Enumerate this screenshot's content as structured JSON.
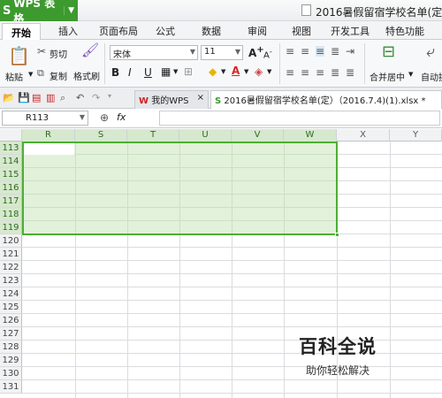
{
  "app": {
    "name": "WPS 表格",
    "logo": "S",
    "doc_title": "2016暑假留宿学校名单(定"
  },
  "menu": {
    "tabs": [
      "开始",
      "插入",
      "页面布局",
      "公式",
      "数据",
      "审阅",
      "视图",
      "开发工具",
      "特色功能"
    ]
  },
  "ribbon": {
    "paste": "粘贴",
    "cut": "剪切",
    "copy": "复制",
    "format_painter": "格式刷",
    "font_name": "宋体",
    "font_size": "11",
    "bold": "B",
    "italic": "I",
    "underline": "U",
    "grow_font": "A",
    "shrink_font": "A",
    "merge_center": "合并居中",
    "auto_wrap": "自动换"
  },
  "tabbar": {
    "home_tab": "我的WPS",
    "doc_tab": "2016暑假留宿学校名单(定）（2016.7.4)(1).xlsx *"
  },
  "formula": {
    "namebox": "R113",
    "fx": "fx",
    "value": ""
  },
  "grid": {
    "columns": [
      "R",
      "S",
      "T",
      "U",
      "V",
      "W",
      "X",
      "Y"
    ],
    "rows": [
      "113",
      "114",
      "115",
      "116",
      "117",
      "118",
      "119",
      "120",
      "121",
      "122",
      "123",
      "124",
      "125",
      "126",
      "127",
      "128",
      "129",
      "130",
      "131"
    ],
    "selected_columns": [
      "R",
      "S",
      "T",
      "U",
      "V",
      "W"
    ],
    "selected_rows": [
      "113",
      "114",
      "115",
      "116",
      "117",
      "118",
      "119"
    ]
  },
  "watermark": {
    "title": "百科全说",
    "subtitle": "助你轻松解决"
  },
  "colors": {
    "accent": "#3c9a2e",
    "selection_border": "#4caf32",
    "selection_fill": "#dff0d4"
  }
}
